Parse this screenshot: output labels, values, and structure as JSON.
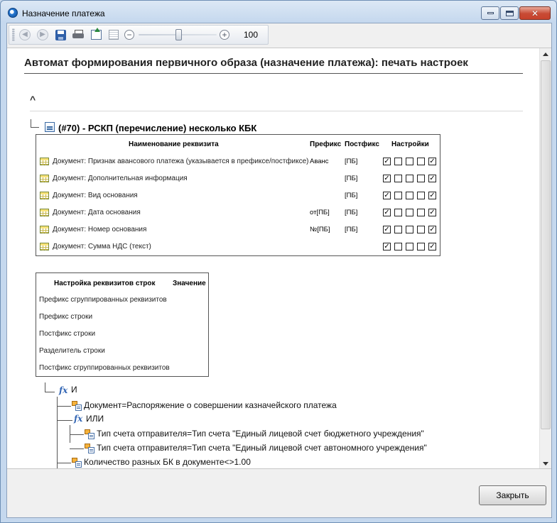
{
  "window": {
    "title": "Назначение платежа"
  },
  "toolbar": {
    "zoom_value": "100",
    "icons": [
      "back-icon",
      "forward-icon",
      "save-icon",
      "print-icon",
      "export-icon",
      "page-setup-icon",
      "zoom-out-icon",
      "zoom-in-icon"
    ]
  },
  "report": {
    "heading": "Автомат формирования первичного образа (назначение платежа): печать настроек",
    "collapse_symbol": "^",
    "node_title": "(#70) - РСКП (перечисление) несколько КБК"
  },
  "requisites_table": {
    "headers": {
      "name": "Наименование реквизита",
      "prefix": "Префикс",
      "postfix": "Постфикс",
      "settings": "Настройки"
    },
    "rows": [
      {
        "name": "Документ: Признак авансового платежа (указывается в префиксе/постфиксе)",
        "prefix": "Аванс",
        "postfix": "[ПБ]",
        "checks": [
          true,
          false,
          false,
          false,
          true
        ]
      },
      {
        "name": "Документ: Дополнительная информация",
        "prefix": "",
        "postfix": "[ПБ]",
        "checks": [
          true,
          false,
          false,
          false,
          true
        ]
      },
      {
        "name": "Документ: Вид основания",
        "prefix": "",
        "postfix": "[ПБ]",
        "checks": [
          true,
          false,
          false,
          false,
          true
        ]
      },
      {
        "name": "Документ: Дата основания",
        "prefix": "от[ПБ]",
        "postfix": "[ПБ]",
        "checks": [
          true,
          false,
          false,
          false,
          true
        ]
      },
      {
        "name": "Документ: Номер основания",
        "prefix": "№[ПБ]",
        "postfix": "[ПБ]",
        "checks": [
          true,
          false,
          false,
          false,
          true
        ]
      },
      {
        "name": "Документ: Сумма НДС (текст)",
        "prefix": "",
        "postfix": "",
        "checks": [
          true,
          false,
          false,
          false,
          true
        ]
      }
    ]
  },
  "string_settings_table": {
    "headers": {
      "name": "Настройка реквизитов строк",
      "value": "Значение"
    },
    "rows": [
      "Префикс сгруппированных реквизитов",
      "Префикс строки",
      "Постфикс строки",
      "Разделитель строки",
      "Постфикс сгруппированных реквизитов"
    ]
  },
  "condition_tree": {
    "fx_symbol": "fx",
    "and_label": "И",
    "doc_condition": "Документ=Распоряжение о совершении казначейского платежа",
    "or_label": "ИЛИ",
    "or_items": [
      "Тип счета отправителя=Тип счета \"Единый лицевой счет бюджетного учреждения\"",
      "Тип счета отправителя=Тип счета \"Единый лицевой счет автономного учреждения\""
    ],
    "count_condition": "Количество разных БК в документе<>1.00"
  },
  "footer": {
    "close_label": "Закрыть"
  }
}
